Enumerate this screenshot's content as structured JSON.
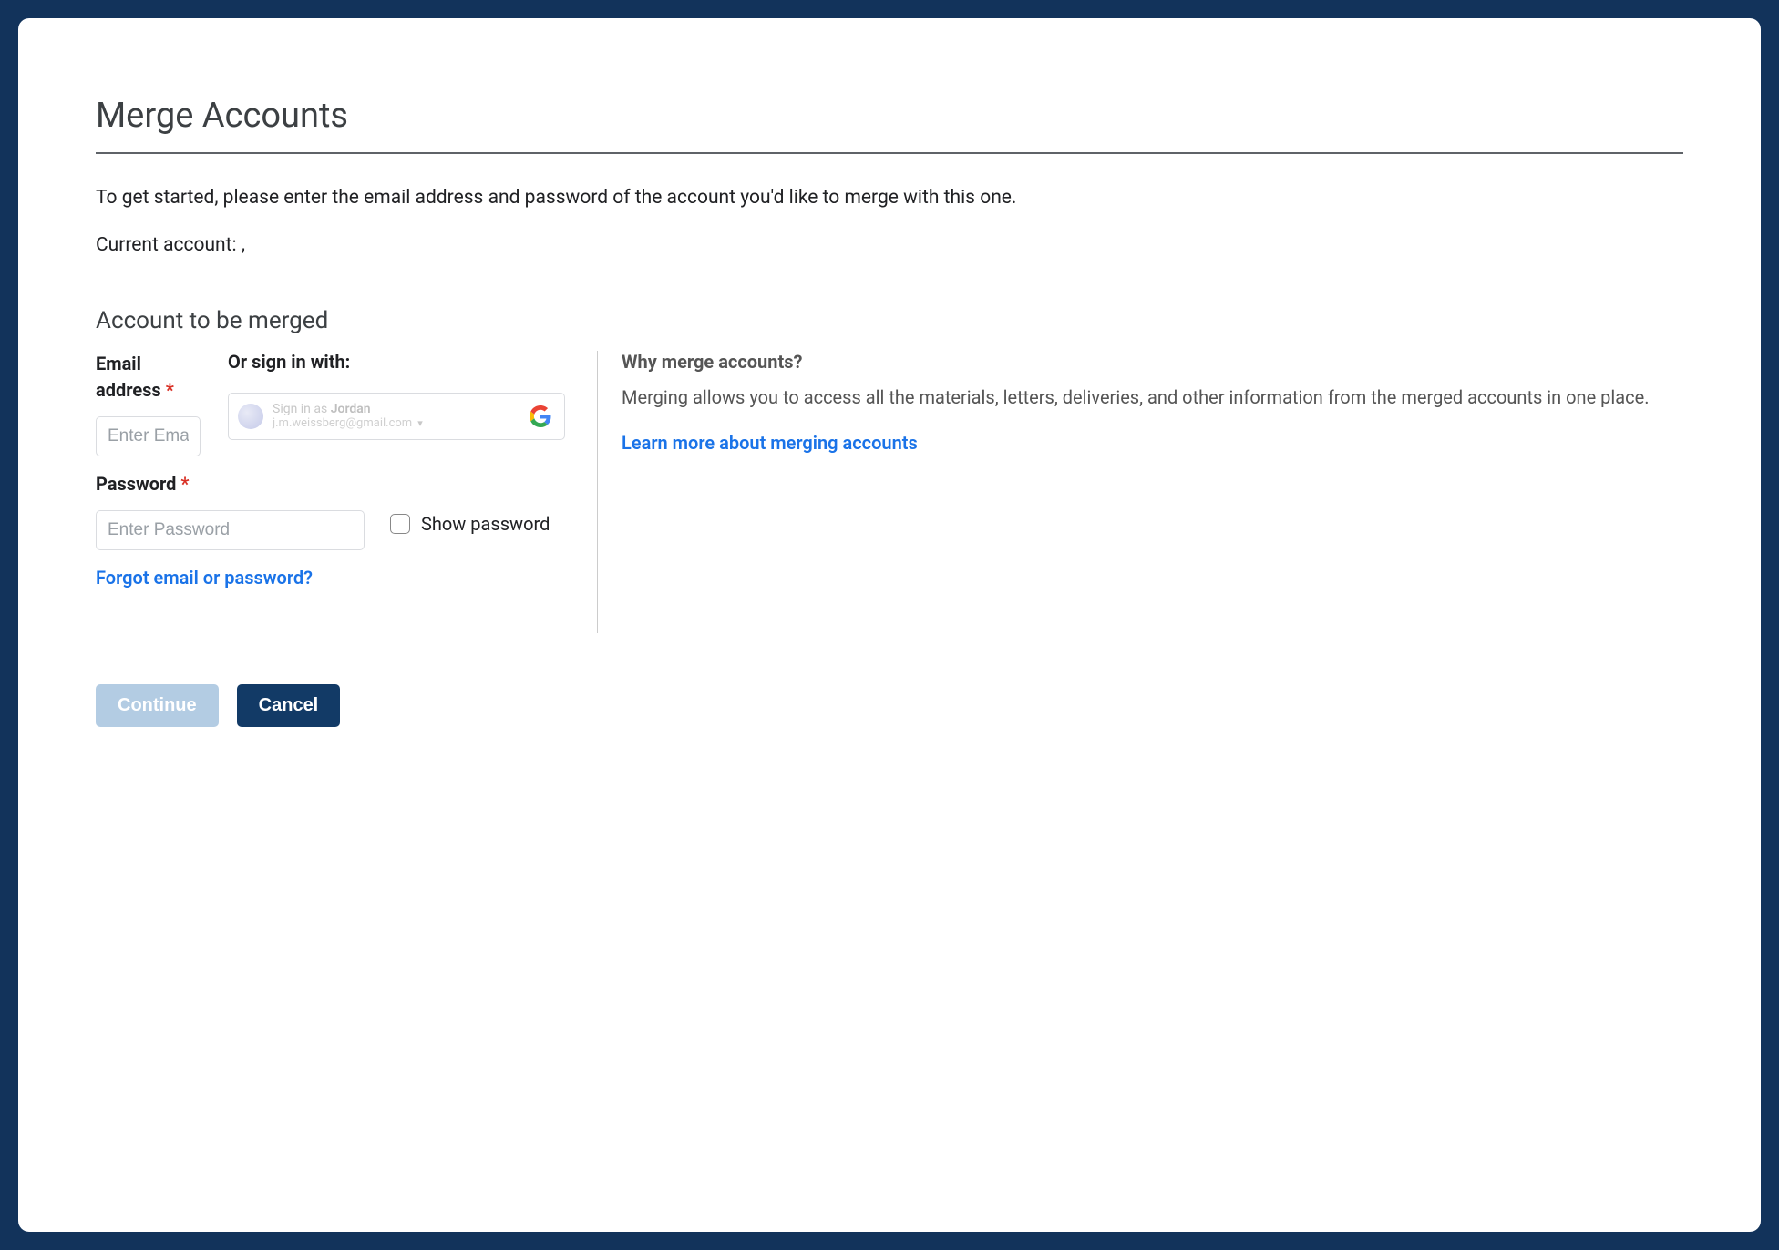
{
  "page": {
    "title": "Merge Accounts",
    "intro": "To get started, please enter the email address and password of the account you'd like to merge with this one.",
    "current_account_label": "Current account: ,",
    "section_title": "Account to be merged"
  },
  "form": {
    "email_label": "Email address",
    "email_placeholder": "Enter Email",
    "required_mark": "*",
    "or_signin_label": "Or sign in with:",
    "google": {
      "prefix": "Sign in as ",
      "name": "Jordan",
      "email": "j.m.weissberg@gmail.com"
    },
    "password_label": "Password",
    "password_placeholder": "Enter Password",
    "show_password_label": "Show password",
    "forgot_link": "Forgot email or password?"
  },
  "info": {
    "heading": "Why merge accounts?",
    "body": "Merging allows you to access all the materials, letters, deliveries, and other information from the merged accounts in one place.",
    "learn_more": "Learn more about merging accounts"
  },
  "buttons": {
    "continue": "Continue",
    "cancel": "Cancel"
  }
}
